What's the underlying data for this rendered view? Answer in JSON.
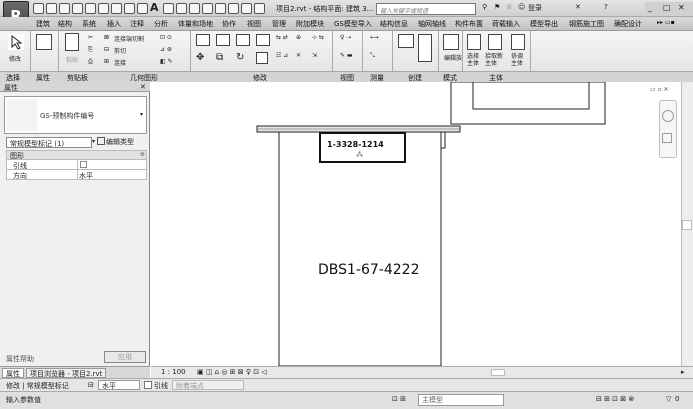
{
  "app": {
    "logo": "R"
  },
  "title": {
    "doc": "项目2.rvt - 结构平面: 建筑 3...",
    "search_placeholder": "键入关键字或短语",
    "login": "登录"
  },
  "tabs": [
    "建筑",
    "结构",
    "系统",
    "插入",
    "注释",
    "分析",
    "体量和场地",
    "协作",
    "视图",
    "管理",
    "附加模块",
    "GS模型导入",
    "结构信息",
    "轴网轴线",
    "构件布置",
    "荷载输入",
    "模型导出",
    "钢筋施工图",
    "确配设计"
  ],
  "ribbon": {
    "modify": "修改",
    "paste": "粘贴",
    "cut_geom": "连接端切割",
    "cut": "剪切",
    "join": "连接",
    "edit_family": "编辑族",
    "select_host": "选择主体",
    "pick_new_host": "拾取新主体",
    "coordinate_host": "协调主体",
    "groups": [
      "选择",
      "属性",
      "剪贴板",
      "几何图形",
      "修改",
      "视图",
      "测量",
      "创建",
      "模式",
      "主体"
    ]
  },
  "properties": {
    "header": "属性",
    "type_name": "GS-预制构件编号",
    "filter": "常规模型标记 (1)",
    "edit_type": "编辑类型",
    "section": "图形",
    "rows": [
      {
        "key": "引线",
        "value": ""
      },
      {
        "key": "方向",
        "value": "水平"
      }
    ],
    "help": "属性帮助",
    "apply": "应用",
    "tabs": [
      "属性",
      "项目浏览器 - 项目2.rvt"
    ]
  },
  "canvas": {
    "tag_text": "1-3328-1214",
    "label_text": "DBS1-67-4222"
  },
  "viewbar": {
    "scale": "1 : 100"
  },
  "options": {
    "context": "修改 | 常规模型标记",
    "orientation": "水平",
    "leader": "引线",
    "attached": "附着端点"
  },
  "status": {
    "text": "输入参数值",
    "model": "主模型",
    "filter_count": "0"
  }
}
